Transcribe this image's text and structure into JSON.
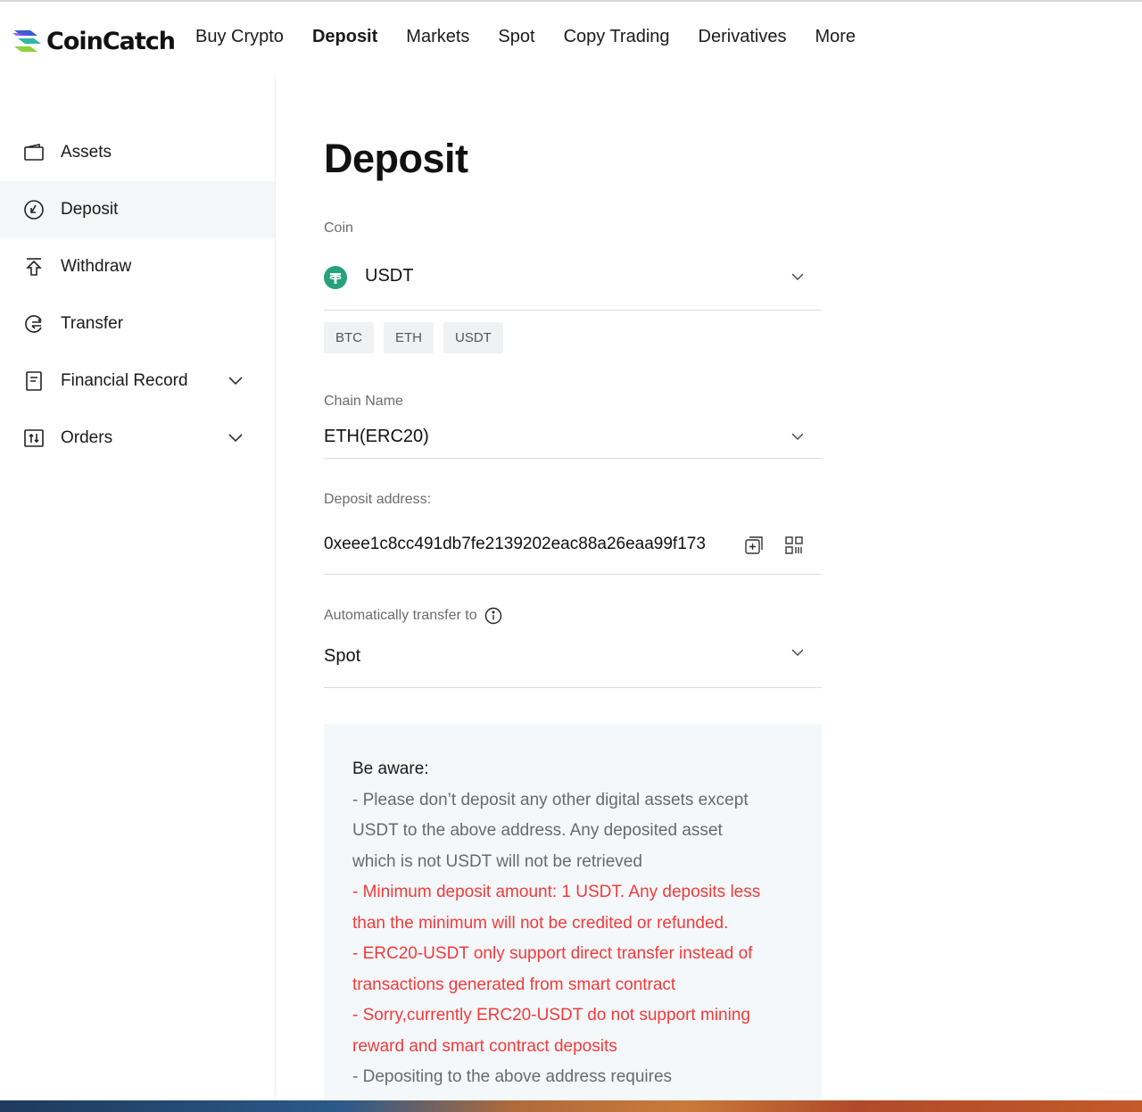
{
  "brand": {
    "name": "CoinCatch"
  },
  "nav": {
    "items": [
      "Buy Crypto",
      "Deposit",
      "Markets",
      "Spot",
      "Copy Trading",
      "Derivatives",
      "More"
    ],
    "active": "Deposit"
  },
  "sidebar": {
    "items": [
      {
        "label": "Assets",
        "icon": "wallet-icon"
      },
      {
        "label": "Deposit",
        "icon": "deposit-icon",
        "active": true
      },
      {
        "label": "Withdraw",
        "icon": "withdraw-icon"
      },
      {
        "label": "Transfer",
        "icon": "transfer-icon"
      },
      {
        "label": "Financial Record",
        "icon": "record-icon",
        "expandable": true
      },
      {
        "label": "Orders",
        "icon": "orders-icon",
        "expandable": true
      }
    ]
  },
  "page": {
    "title": "Deposit",
    "coin": {
      "label": "Coin",
      "value": "USDT",
      "icon": "tether-icon"
    },
    "quick_coins": [
      "BTC",
      "ETH",
      "USDT"
    ],
    "chain": {
      "label": "Chain Name",
      "value": "ETH(ERC20)"
    },
    "address": {
      "label": "Deposit address:",
      "value": "0xeee1c8cc491db7fe2139202eac88a26eaa99f173"
    },
    "auto_transfer": {
      "label": "Automatically transfer to",
      "value": "Spot"
    },
    "notice": {
      "heading": "Be aware:",
      "lines": [
        {
          "text": "- Please don’t deposit any other digital assets except",
          "tone": "normal"
        },
        {
          "text": "USDT to the above address. Any deposited asset",
          "tone": "normal"
        },
        {
          "text": "which is not USDT will not be retrieved",
          "tone": "normal"
        },
        {
          "text": "- Minimum deposit amount: 1 USDT. Any deposits less",
          "tone": "red"
        },
        {
          "text": "than the minimum will not be credited or refunded.",
          "tone": "red"
        },
        {
          "text": "- ERC20-USDT only support direct transfer instead of",
          "tone": "red"
        },
        {
          "text": "transactions generated from smart contract",
          "tone": "red"
        },
        {
          "text": "- Sorry,currently ERC20-USDT do not support mining",
          "tone": "red"
        },
        {
          "text": "reward and smart contract deposits",
          "tone": "red"
        },
        {
          "text": "- Depositing to the above address requires",
          "tone": "normal"
        }
      ]
    }
  },
  "colors": {
    "accent_red": "#f23a3a",
    "tether_green": "#26a17b",
    "logo_blue": "#3a5bd9",
    "logo_green": "#8fd13f"
  }
}
